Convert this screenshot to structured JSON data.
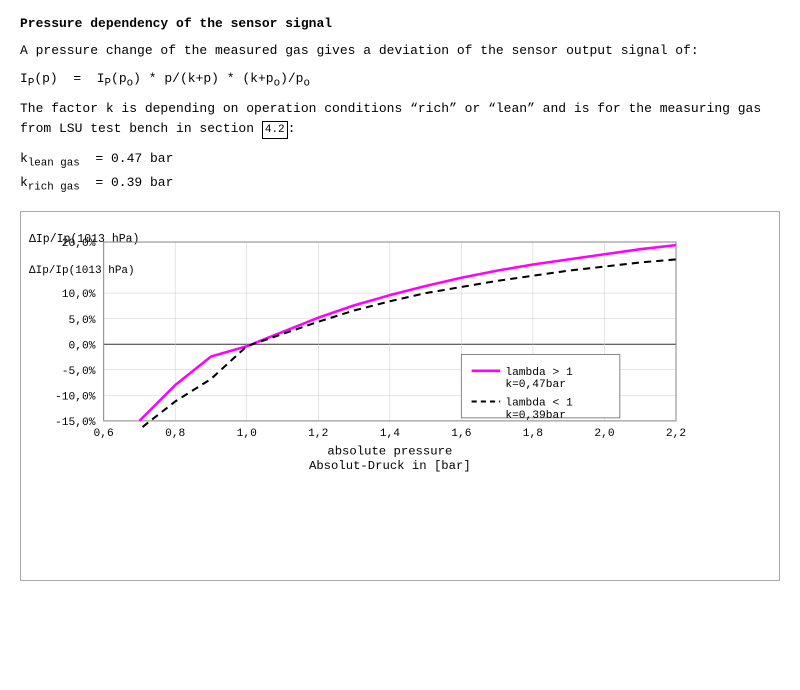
{
  "title": "Pressure dependency of the sensor signal",
  "paragraph1": "A pressure change of the measured gas gives a deviation of the sensor output signal of:",
  "formula": "IP(p)  =  IP(p₀) * p/(k+p) * (k+p₀)/p₀",
  "factor_text": "The factor k is depending on operation conditions “rich” or “lean” and is for the measuring gas from LSU test bench in section",
  "section_ref": "4.2",
  "k_lean_label": "k",
  "k_lean_sub": "lean gas",
  "k_lean_value": "= 0.47 bar",
  "k_rich_label": "k",
  "k_rich_sub": "rich gas",
  "k_rich_value": "= 0.39 bar",
  "chart": {
    "y_label": "ΔIp/Ip(1013 hPa)",
    "x_label_line1": "absolute pressure",
    "x_label_line2": "Absolut-Druck in [bar]",
    "y_ticks": [
      "20,0%",
      "10,0%",
      "5,0%",
      "0,0%",
      "-5,0%",
      "-10,0%",
      "-15,0%"
    ],
    "x_ticks": [
      "0,6",
      "0,8",
      "1,0",
      "1,2",
      "1,4",
      "1,6",
      "1,8",
      "2,0",
      "2,2"
    ],
    "legend": {
      "line1_label": "lambda > 1",
      "line1_sub": "k=0,47bar",
      "line2_label": "lambda < 1",
      "line2_sub": "k=0,39bar"
    }
  }
}
